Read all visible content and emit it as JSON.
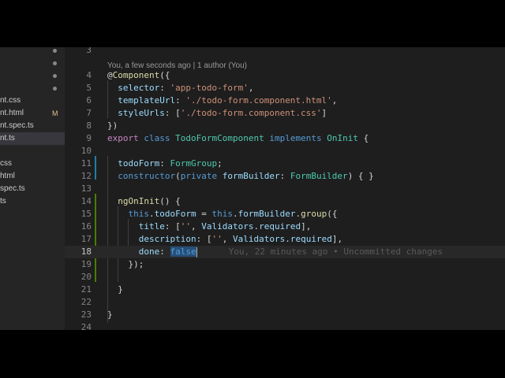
{
  "sidebar": {
    "files": [
      {
        "name": "nt.css",
        "badge": "",
        "active": false
      },
      {
        "name": "nt.html",
        "badge": "M",
        "active": false
      },
      {
        "name": "nt.spec.ts",
        "badge": "",
        "active": false
      },
      {
        "name": "nt.ts",
        "badge": "",
        "active": true
      },
      {
        "name": "css",
        "badge": "",
        "active": false
      },
      {
        "name": "html",
        "badge": "",
        "active": false
      },
      {
        "name": "spec.ts",
        "badge": "",
        "active": false
      },
      {
        "name": "ts",
        "badge": "",
        "active": false
      }
    ]
  },
  "editor": {
    "blame_header": "You, a few seconds ago | 1 author (You)",
    "current_line": 18,
    "inline_blame": "You, 22 minutes ago • Uncommitted changes",
    "lines": [
      {
        "n": "3",
        "tokens": []
      },
      {
        "n": "4",
        "tokens": [
          {
            "c": "d",
            "t": "@"
          },
          {
            "c": "f",
            "t": "Component"
          },
          {
            "c": "d",
            "t": "({"
          }
        ]
      },
      {
        "n": "5",
        "tokens": [
          {
            "c": "d",
            "t": "  "
          },
          {
            "c": "p",
            "t": "selector"
          },
          {
            "c": "d",
            "t": ": "
          },
          {
            "c": "s",
            "t": "'app-todo-form'"
          },
          {
            "c": "d",
            "t": ","
          }
        ]
      },
      {
        "n": "6",
        "tokens": [
          {
            "c": "d",
            "t": "  "
          },
          {
            "c": "p",
            "t": "templateUrl"
          },
          {
            "c": "d",
            "t": ": "
          },
          {
            "c": "s",
            "t": "'./todo-form.component.html'"
          },
          {
            "c": "d",
            "t": ","
          }
        ]
      },
      {
        "n": "7",
        "tokens": [
          {
            "c": "d",
            "t": "  "
          },
          {
            "c": "p",
            "t": "styleUrls"
          },
          {
            "c": "d",
            "t": ": ["
          },
          {
            "c": "s",
            "t": "'./todo-form.component.css'"
          },
          {
            "c": "d",
            "t": "]"
          }
        ]
      },
      {
        "n": "8",
        "tokens": [
          {
            "c": "d",
            "t": "})"
          }
        ]
      },
      {
        "n": "9",
        "tokens": [
          {
            "c": "kc",
            "t": "export"
          },
          {
            "c": "d",
            "t": " "
          },
          {
            "c": "k",
            "t": "class"
          },
          {
            "c": "d",
            "t": " "
          },
          {
            "c": "t",
            "t": "TodoFormComponent"
          },
          {
            "c": "d",
            "t": " "
          },
          {
            "c": "k",
            "t": "implements"
          },
          {
            "c": "d",
            "t": " "
          },
          {
            "c": "t",
            "t": "OnInit"
          },
          {
            "c": "d",
            "t": " {"
          }
        ]
      },
      {
        "n": "10",
        "tokens": []
      },
      {
        "n": "11",
        "tokens": [
          {
            "c": "d",
            "t": "  "
          },
          {
            "c": "p",
            "t": "todoForm"
          },
          {
            "c": "d",
            "t": ": "
          },
          {
            "c": "t",
            "t": "FormGroup"
          },
          {
            "c": "d",
            "t": ";"
          }
        ]
      },
      {
        "n": "12",
        "tokens": [
          {
            "c": "d",
            "t": "  "
          },
          {
            "c": "k",
            "t": "constructor"
          },
          {
            "c": "d",
            "t": "("
          },
          {
            "c": "k",
            "t": "private"
          },
          {
            "c": "d",
            "t": " "
          },
          {
            "c": "p",
            "t": "formBuilder"
          },
          {
            "c": "d",
            "t": ": "
          },
          {
            "c": "t",
            "t": "FormBuilder"
          },
          {
            "c": "d",
            "t": ") { }"
          }
        ]
      },
      {
        "n": "13",
        "tokens": []
      },
      {
        "n": "14",
        "tokens": [
          {
            "c": "d",
            "t": "  "
          },
          {
            "c": "f",
            "t": "ngOnInit"
          },
          {
            "c": "d",
            "t": "() {"
          }
        ]
      },
      {
        "n": "15",
        "tokens": [
          {
            "c": "d",
            "t": "    "
          },
          {
            "c": "k",
            "t": "this"
          },
          {
            "c": "d",
            "t": "."
          },
          {
            "c": "p",
            "t": "todoForm"
          },
          {
            "c": "d",
            "t": " = "
          },
          {
            "c": "k",
            "t": "this"
          },
          {
            "c": "d",
            "t": "."
          },
          {
            "c": "p",
            "t": "formBuilder"
          },
          {
            "c": "d",
            "t": "."
          },
          {
            "c": "f",
            "t": "group"
          },
          {
            "c": "d",
            "t": "({"
          }
        ]
      },
      {
        "n": "16",
        "tokens": [
          {
            "c": "d",
            "t": "      "
          },
          {
            "c": "p",
            "t": "title"
          },
          {
            "c": "d",
            "t": ": ["
          },
          {
            "c": "s",
            "t": "''"
          },
          {
            "c": "d",
            "t": ", "
          },
          {
            "c": "p",
            "t": "Validators"
          },
          {
            "c": "d",
            "t": "."
          },
          {
            "c": "p",
            "t": "required"
          },
          {
            "c": "d",
            "t": "],"
          }
        ]
      },
      {
        "n": "17",
        "tokens": [
          {
            "c": "d",
            "t": "      "
          },
          {
            "c": "p",
            "t": "description"
          },
          {
            "c": "d",
            "t": ": ["
          },
          {
            "c": "s",
            "t": "''"
          },
          {
            "c": "d",
            "t": ", "
          },
          {
            "c": "p",
            "t": "Validators"
          },
          {
            "c": "d",
            "t": "."
          },
          {
            "c": "p",
            "t": "required"
          },
          {
            "c": "d",
            "t": "],"
          }
        ]
      },
      {
        "n": "18",
        "tokens": [
          {
            "c": "d",
            "t": "      "
          },
          {
            "c": "p",
            "t": "done"
          },
          {
            "c": "d",
            "t": ": "
          },
          {
            "c": "k sel",
            "t": "false"
          }
        ]
      },
      {
        "n": "19",
        "tokens": [
          {
            "c": "d",
            "t": "    });"
          }
        ]
      },
      {
        "n": "20",
        "tokens": []
      },
      {
        "n": "21",
        "tokens": [
          {
            "c": "d",
            "t": "  }"
          }
        ]
      },
      {
        "n": "22",
        "tokens": []
      },
      {
        "n": "23",
        "tokens": [
          {
            "c": "d",
            "t": "}"
          }
        ]
      },
      {
        "n": "24",
        "tokens": []
      }
    ]
  },
  "colors": {
    "background": "#1e1e1e",
    "sidebar": "#252526",
    "modified_badge": "#e2c08d",
    "git_added": "#487e02",
    "git_modified": "#1b81a8"
  }
}
